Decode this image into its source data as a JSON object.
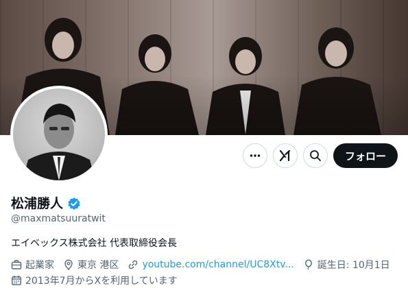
{
  "profile": {
    "display_name": "松浦勝人",
    "handle": "@maxmatsuuratwit",
    "bio": "エイベックス株式会社 代表取締役会長",
    "verified": true,
    "occupation": "起業家",
    "location": "東京 港区",
    "website": "youtube.com/channel/UC8Xtv...",
    "birthday": "誕生日: 10月1日",
    "joined": "2013年7月からXを利用しています"
  },
  "actions": {
    "more_icon": "more-icon",
    "grok_icon": "grok-icon",
    "search_icon": "search-icon",
    "follow_label": "フォロー"
  },
  "colors": {
    "verified_badge": "#1d9bf0",
    "link": "#1d9bf0",
    "follow_button": "#0f1419",
    "secondary_text": "#536471"
  }
}
